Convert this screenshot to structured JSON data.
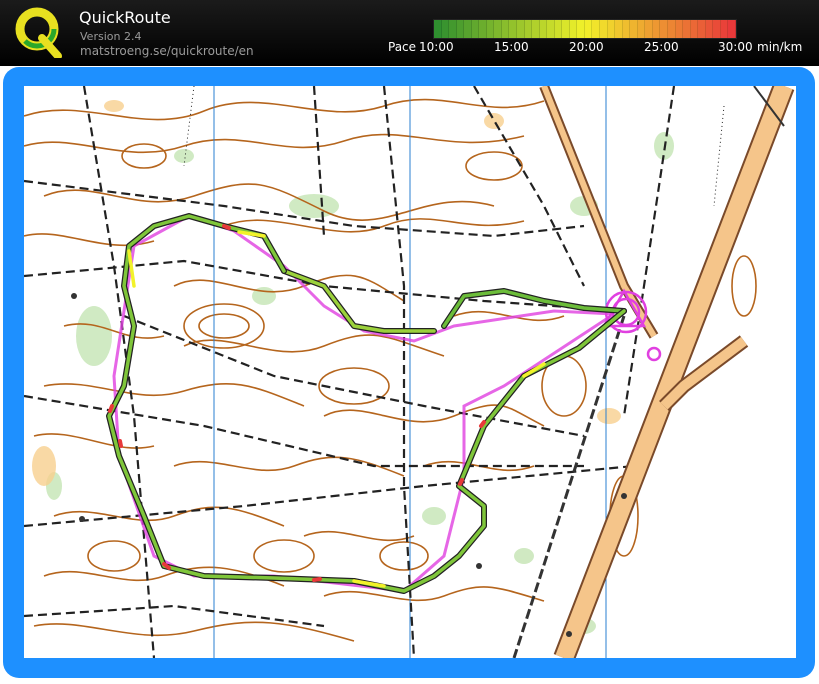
{
  "app": {
    "title": "QuickRoute",
    "version": "Version 2.4",
    "url": "matstroeng.se/quickroute/en"
  },
  "pace_legend": {
    "label": "Pace",
    "ticks": [
      "10:00",
      "15:00",
      "20:00",
      "25:00",
      "30:00"
    ],
    "unit": "min/km",
    "colors": {
      "fast": "#2f8f2f",
      "mid": "#f2f22a",
      "slow": "#e8393a"
    }
  },
  "colors": {
    "frame": "#1e90ff",
    "contour": "#b5651d",
    "course": "#e040e0",
    "road": "#f5c58a"
  },
  "icons": {
    "logo": "quickroute-q-logo",
    "start": "start-triangle",
    "finish": "finish-double-circle"
  }
}
